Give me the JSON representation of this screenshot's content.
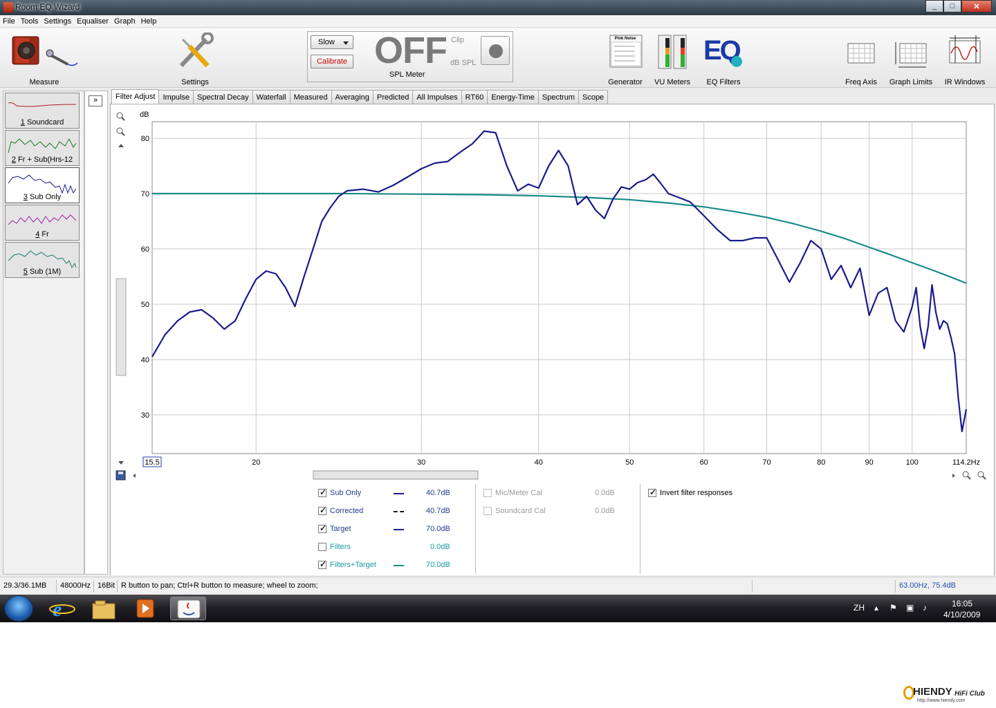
{
  "window": {
    "title": "Room EQ Wizard",
    "controls": [
      "_",
      "□",
      "✕"
    ]
  },
  "menu": [
    "File",
    "Tools",
    "Settings",
    "Equaliser",
    "Graph",
    "Help"
  ],
  "toolbar": {
    "measure": "Measure",
    "settings": "Settings",
    "spl": {
      "speed": "Slow",
      "calibrate": "Calibrate",
      "display": "OFF",
      "clip": "Clip",
      "unit": "dB SPL",
      "label": "SPL Meter"
    },
    "generator": "Generator",
    "generator_panel": "Pink Noise",
    "vu": "VU Meters",
    "eq": "EQ Filters",
    "eq_logo": "EQ",
    "freq_axis": "Freq Axis",
    "graph_limits": "Graph Limits",
    "ir_windows": "IR Windows"
  },
  "measurements": [
    {
      "num": "1",
      "name": " Soundcard",
      "color": "#b02020"
    },
    {
      "num": "2",
      "name": " Fr + Sub(Hrs-12",
      "color": "#1a7a1a"
    },
    {
      "num": "3",
      "name": " Sub Only",
      "color": "#1a1a8a"
    },
    {
      "num": "4",
      "name": " Fr",
      "color": "#a020a0"
    },
    {
      "num": "5",
      "name": " Sub (1M)",
      "color": "#1a7a6a"
    }
  ],
  "expander": "»",
  "tabs": [
    "Filter Adjust",
    "Impulse",
    "Spectral Decay",
    "Waterfall",
    "Measured",
    "Averaging",
    "Predicted",
    "All Impulses",
    "RT60",
    "Energy-Time",
    "Spectrum",
    "Scope"
  ],
  "chart_data": {
    "type": "line",
    "ylabel": "dB",
    "xscale": "log",
    "xlim": [
      15.5,
      114.2
    ],
    "ylim": [
      23,
      83
    ],
    "x_ticks": [
      20,
      30,
      40,
      50,
      60,
      70,
      80,
      90,
      100
    ],
    "x_tick_labels": [
      "20",
      "30",
      "40",
      "50",
      "60",
      "70",
      "80",
      "90",
      "100"
    ],
    "x_start_label": "15.5",
    "x_end_label": "114.2Hz",
    "y_ticks": [
      30,
      40,
      50,
      60,
      70,
      80
    ],
    "grid": true,
    "series": [
      {
        "name": "Sub Only",
        "color": "#1a1a8a",
        "x": [
          15.5,
          16,
          16.5,
          17,
          17.5,
          18,
          18.5,
          19,
          19.5,
          20,
          20.5,
          21,
          21.5,
          22,
          22.5,
          23,
          23.5,
          24,
          24.5,
          25,
          26,
          27,
          28,
          29,
          30,
          31,
          32,
          33,
          34,
          35,
          36,
          37,
          38,
          39,
          40,
          41,
          42,
          43,
          44,
          45,
          46,
          47,
          48,
          49,
          50,
          51,
          52,
          53,
          54,
          55,
          56,
          57,
          58,
          60,
          62,
          64,
          66,
          68,
          70,
          72,
          74,
          76,
          78,
          80,
          82,
          84,
          86,
          88,
          90,
          92,
          94,
          96,
          98,
          100,
          101,
          102,
          103,
          104,
          105,
          106,
          107,
          108,
          109,
          110,
          111,
          112,
          113,
          114.2
        ],
        "y": [
          40.5,
          44.5,
          47,
          48.6,
          49,
          47.5,
          45.5,
          47,
          51,
          54.5,
          56,
          55.5,
          53,
          49.6,
          55,
          60,
          65,
          67.5,
          69.5,
          70.5,
          70.8,
          70.3,
          71.5,
          73,
          74.5,
          75.5,
          75.8,
          77.5,
          79,
          81.3,
          81,
          75,
          70.5,
          71.7,
          71,
          75,
          77.8,
          75,
          68,
          69.5,
          67,
          65.5,
          69,
          71.2,
          70.8,
          72,
          72.5,
          73.5,
          71.8,
          70,
          69.5,
          69,
          68.5,
          66,
          63.5,
          61.5,
          61.5,
          62,
          62,
          58,
          54,
          57.5,
          61.5,
          60,
          54.5,
          57,
          53,
          56.5,
          48,
          52,
          53,
          47,
          45,
          49.5,
          53,
          46,
          42,
          46,
          53.5,
          48.5,
          45.5,
          47,
          46.5,
          44,
          41,
          33,
          27,
          31
        ]
      },
      {
        "name": "Filters+Target",
        "color": "#1a8a8a",
        "x": [
          15.5,
          20,
          25,
          30,
          35,
          40,
          45,
          50,
          55,
          60,
          65,
          70,
          75,
          80,
          85,
          90,
          95,
          100,
          105,
          110,
          114.2
        ],
        "y": [
          70,
          70,
          70,
          69.9,
          69.8,
          69.6,
          69.3,
          68.9,
          68.3,
          67.6,
          66.7,
          65.7,
          64.5,
          63.2,
          61.8,
          60.3,
          58.9,
          57.5,
          56.2,
          54.9,
          53.8
        ]
      }
    ]
  },
  "status_right": "63.00Hz,  75.4dB",
  "legend": {
    "items": [
      {
        "label": "Sub Only",
        "value": "40.7dB",
        "checked": true,
        "style": "solid"
      },
      {
        "label": "Corrected",
        "value": "40.7dB",
        "checked": true,
        "style": "dashed"
      },
      {
        "label": "Target",
        "value": "70.0dB",
        "checked": true,
        "style": "solid"
      },
      {
        "label": "Filters",
        "value": "0.0dB",
        "checked": false,
        "style": "none"
      },
      {
        "label": "Filters+Target",
        "value": "70.0dB",
        "checked": true,
        "style": "teal"
      }
    ],
    "cal": [
      {
        "label": "Mic/Meter Cal",
        "value": "0.0dB"
      },
      {
        "label": "Soundcard Cal",
        "value": "0.0dB"
      }
    ],
    "invert": "Invert filter responses"
  },
  "status": {
    "memory": "29.3/36.1MB",
    "rate": "48000Hz",
    "bits": "16Bit",
    "hint": "R button to pan; Ctrl+R button to measure; wheel to zoom;"
  },
  "taskbar": {
    "lang": "ZH",
    "time": "16:05",
    "date": "4/10/2009"
  },
  "watermark": {
    "brand": "HIENDY",
    "sub": "HiFi Club",
    "url": "http://www.hiendy.com"
  }
}
